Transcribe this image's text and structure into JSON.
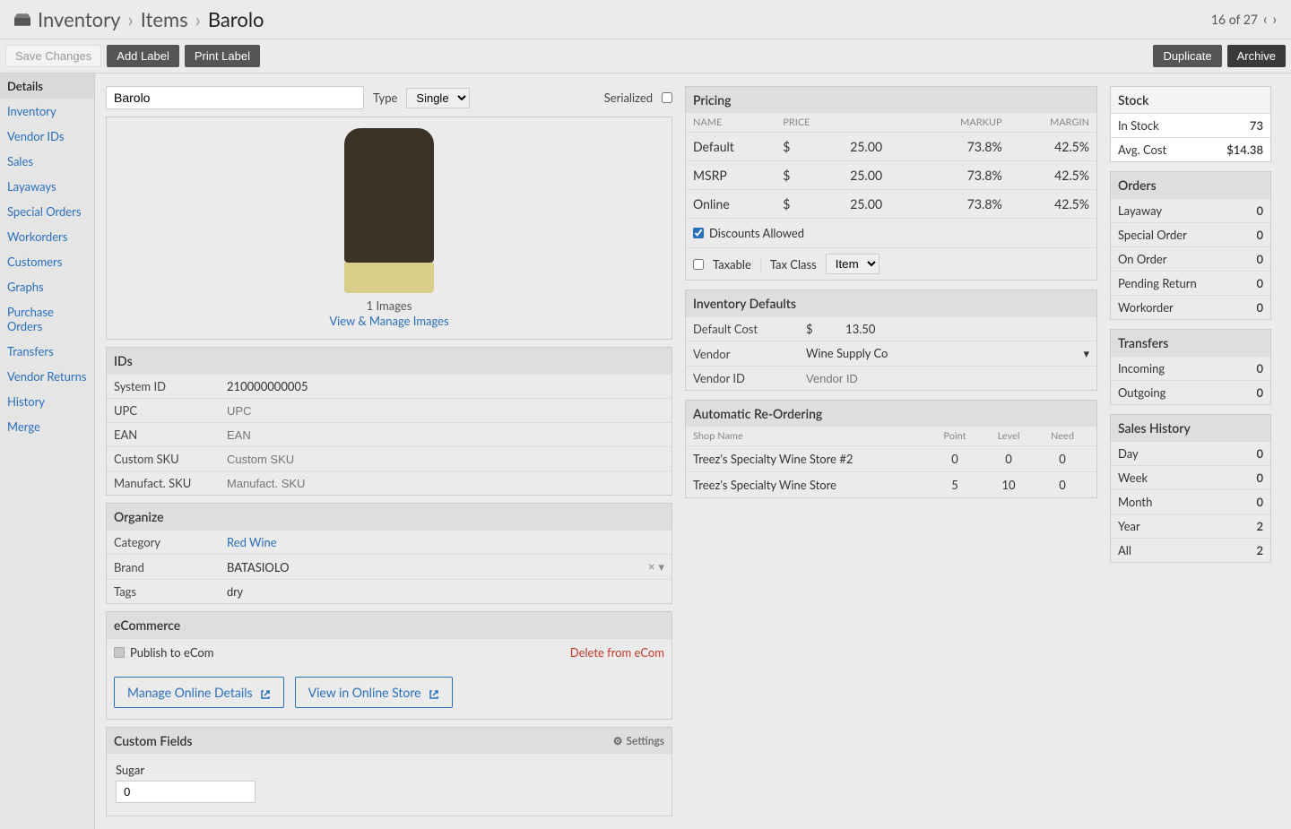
{
  "breadcrumb": {
    "inventory": "Inventory",
    "items": "Items",
    "current": "Barolo"
  },
  "pager": {
    "text": "16 of 27"
  },
  "toolbar": {
    "save": "Save Changes",
    "addlabel": "Add Label",
    "printlabel": "Print Label",
    "duplicate": "Duplicate",
    "archive": "Archive"
  },
  "sidebar": [
    "Details",
    "Inventory",
    "Vendor IDs",
    "Sales",
    "Layaways",
    "Special Orders",
    "Workorders",
    "Customers",
    "Graphs",
    "Purchase Orders",
    "Transfers",
    "Vendor Returns",
    "History",
    "Merge"
  ],
  "item": {
    "name": "Barolo",
    "type_label": "Type",
    "type_value": "Single",
    "serialized_label": "Serialized"
  },
  "image": {
    "caption": "1 Images",
    "link": "View & Manage Images"
  },
  "ids": {
    "header": "IDs",
    "system_label": "System ID",
    "system_value": "210000000005",
    "upc_label": "UPC",
    "upc_ph": "UPC",
    "ean_label": "EAN",
    "ean_ph": "EAN",
    "csku_label": "Custom SKU",
    "csku_ph": "Custom SKU",
    "msku_label": "Manufact. SKU",
    "msku_ph": "Manufact. SKU"
  },
  "organize": {
    "header": "Organize",
    "cat_label": "Category",
    "cat_value": "Red Wine",
    "brand_label": "Brand",
    "brand_value": "BATASIOLO",
    "tags_label": "Tags",
    "tags_value": "dry"
  },
  "ecom": {
    "header": "eCommerce",
    "publish": "Publish to eCom",
    "delete": "Delete from eCom",
    "manage": "Manage Online Details",
    "view": "View in Online Store"
  },
  "custom": {
    "header": "Custom Fields",
    "settings": "Settings",
    "sugar_label": "Sugar",
    "sugar_value": "0"
  },
  "pricing": {
    "header": "Pricing",
    "cols": {
      "name": "NAME",
      "price": "PRICE",
      "markup": "MARKUP",
      "margin": "MARGIN"
    },
    "rows": [
      {
        "name": "Default",
        "cur": "$",
        "price": "25.00",
        "markup": "73.8%",
        "margin": "42.5%"
      },
      {
        "name": "MSRP",
        "cur": "$",
        "price": "25.00",
        "markup": "73.8%",
        "margin": "42.5%"
      },
      {
        "name": "Online",
        "cur": "$",
        "price": "25.00",
        "markup": "73.8%",
        "margin": "42.5%"
      }
    ],
    "discounts": "Discounts Allowed",
    "taxable": "Taxable",
    "taxclass_label": "Tax Class",
    "taxclass_value": "Item"
  },
  "invdef": {
    "header": "Inventory Defaults",
    "cost_label": "Default Cost",
    "cost_cur": "$",
    "cost_value": "13.50",
    "vendor_label": "Vendor",
    "vendor_value": "Wine Supply Co",
    "vendorid_label": "Vendor ID",
    "vendorid_ph": "Vendor ID"
  },
  "reorder": {
    "header": "Automatic Re-Ordering",
    "cols": {
      "shop": "Shop Name",
      "point": "Point",
      "level": "Level",
      "need": "Need"
    },
    "rows": [
      {
        "shop": "Treez's Specialty Wine Store #2",
        "point": "0",
        "level": "0",
        "need": "0"
      },
      {
        "shop": "Treez's Specialty Wine Store",
        "point": "5",
        "level": "10",
        "need": "0"
      }
    ]
  },
  "stock": {
    "header": "Stock",
    "instock_label": "In Stock",
    "instock": "73",
    "avg_label": "Avg. Cost",
    "avg": "$14.38"
  },
  "orders": {
    "header": "Orders",
    "rows": [
      {
        "k": "Layaway",
        "v": "0"
      },
      {
        "k": "Special Order",
        "v": "0"
      },
      {
        "k": "On Order",
        "v": "0"
      },
      {
        "k": "Pending Return",
        "v": "0"
      },
      {
        "k": "Workorder",
        "v": "0"
      }
    ]
  },
  "transfers": {
    "header": "Transfers",
    "rows": [
      {
        "k": "Incoming",
        "v": "0"
      },
      {
        "k": "Outgoing",
        "v": "0"
      }
    ]
  },
  "salesh": {
    "header": "Sales History",
    "rows": [
      {
        "k": "Day",
        "v": "0"
      },
      {
        "k": "Week",
        "v": "0"
      },
      {
        "k": "Month",
        "v": "0"
      },
      {
        "k": "Year",
        "v": "2"
      },
      {
        "k": "All",
        "v": "2"
      }
    ]
  }
}
